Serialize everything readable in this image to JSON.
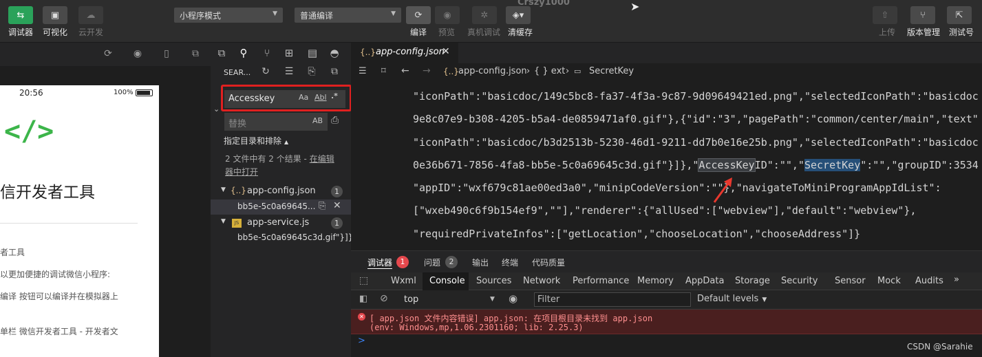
{
  "toolbar": {
    "left_buttons": [
      {
        "label": "调试器",
        "icon": "debugger-icon"
      },
      {
        "label": "可视化",
        "icon": "visual-icon"
      },
      {
        "label": "云开发",
        "icon": "cloud-icon"
      }
    ],
    "mode_select": "小程序模式",
    "compile_select": "普通编译",
    "center_labels": {
      "compile": "编译",
      "preview": "预览",
      "real_debug": "真机调试",
      "clear_cache": "清缓存"
    },
    "faint_title": "Crszy1000",
    "right_labels": {
      "upload": "上传",
      "version": "版本管理",
      "test": "测试号"
    }
  },
  "simulator": {
    "time": "20:56",
    "battery": "100%",
    "logo": "</>",
    "title": "信开发者工具",
    "lines": [
      "者工具",
      "以更加便捷的调试微信小程序:",
      "编译 按钮可以编译并在模拟器上",
      "单栏 微信开发者工具 - 开发者文"
    ]
  },
  "search": {
    "header": "SEAR...",
    "query": "Accesskey",
    "query_opts": [
      "Aa",
      "Abl",
      ".*"
    ],
    "replace_placeholder": "替换",
    "replace_opt": "AB",
    "scope_label": "指定目录和排除",
    "summary_prefix": "2 文件中有 2 个结果 - ",
    "summary_link": "在编辑器中打开",
    "results": [
      {
        "file": "app-config.json",
        "count": "1",
        "match": "bb5e-5c0a69645..."
      },
      {
        "file": "app-service.js",
        "count": "1",
        "match": "bb5e-5c0a69645c3d.gif\"}]}..."
      }
    ]
  },
  "editor": {
    "tab": "app-config.json",
    "breadcrumb": [
      "app-config.json",
      "{ } ext",
      "SecretKey"
    ],
    "lines": [
      "\"iconPath\":\"basicdoc/149c5bc8-fa37-4f3a-9c87-9d09649421ed.png\",\"selectedIconPath\":\"basicdoc",
      "9e8c07e9-b308-4205-b5a4-de0859471af0.gif\"},{\"id\":\"3\",\"pagePath\":\"common/center/main\",\"text\"",
      "\"iconPath\":\"basicdoc/b3d2513b-5230-46d1-9211-dd7b0e16e25b.png\",\"selectedIconPath\":\"basicdoc",
      "\"appID\":\"wxf679c81ae00ed3a0\",\"minipCodeVersion\":\"\"},\"navigateToMiniProgramAppIdList\":",
      "[\"wxeb490c6f9b154ef9\",\"\"],\"renderer\":{\"allUsed\":[\"webview\"],\"default\":\"webview\"},",
      "\"requiredPrivateInfos\":[\"getLocation\",\"chooseLocation\",\"chooseAddress\"]}"
    ],
    "line4": {
      "before": "0e36b671-7856-4fa8-bb5e-5c0a69645c3d.gif\"}]},\"",
      "access": "AccessKey",
      "mid": "ID\":\"\",\"",
      "secret": "SecretKey",
      "after": "\":\"\",\"groupID\":3534"
    }
  },
  "panel": {
    "tabs": [
      {
        "label": "调试器",
        "badge": "1"
      },
      {
        "label": "问题",
        "badge": "2"
      },
      {
        "label": "输出"
      },
      {
        "label": "终端"
      },
      {
        "label": "代码质量"
      }
    ],
    "devtools_tabs": [
      "Wxml",
      "Console",
      "Sources",
      "Network",
      "Performance",
      "Memory",
      "AppData",
      "Storage",
      "Security",
      "Sensor",
      "Mock",
      "Audits"
    ],
    "active_devtab": "Console",
    "context": "top",
    "filter_placeholder": "Filter",
    "levels": "Default levels",
    "error_line1": "[ app.json 文件内容错误] app.json: 在项目根目录未找到 app.json",
    "error_line2": "(env: Windows,mp,1.06.2301160; lib: 2.25.3)",
    "prompt": ">"
  },
  "watermark": "CSDN @Sarahie",
  "colors": {
    "highlight_box": "#e02020",
    "arrow": "#e8382e",
    "error_bg": "#4a1f1f",
    "accent_green": "#2aa25a"
  }
}
